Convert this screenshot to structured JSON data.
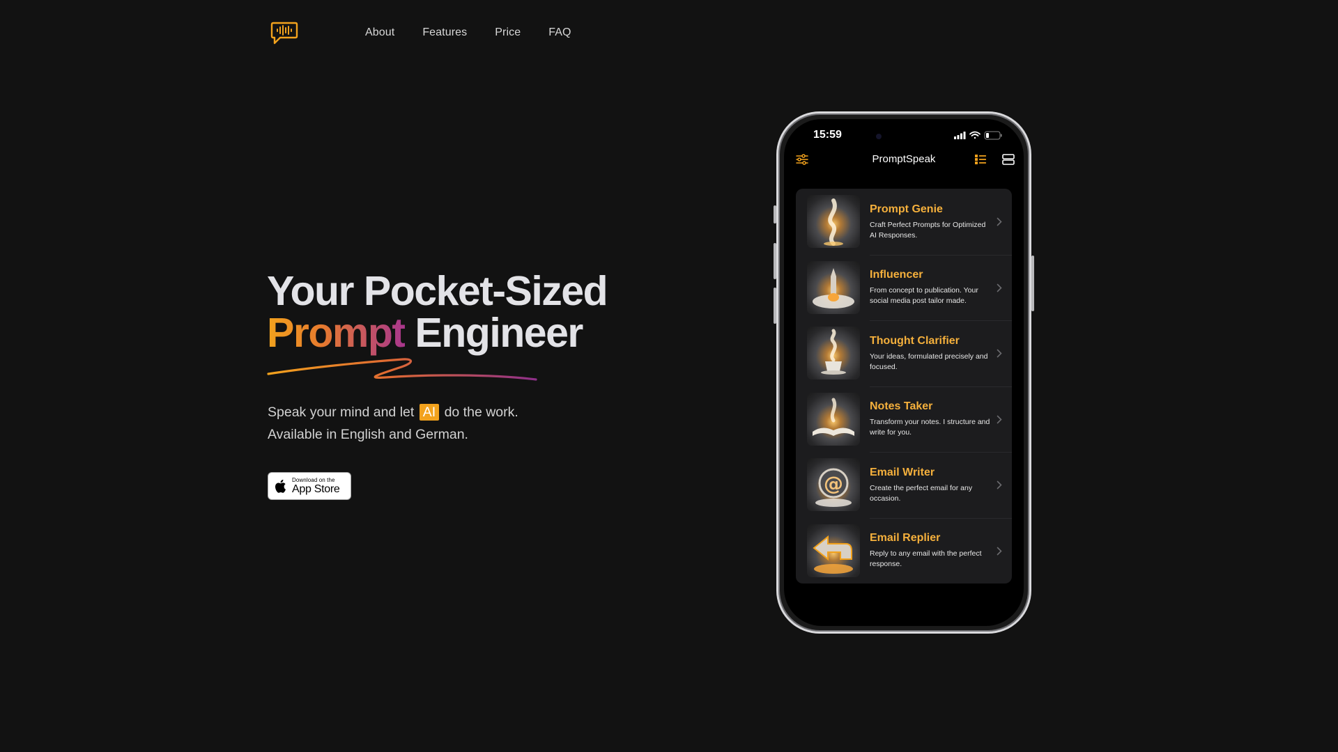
{
  "nav": {
    "logo_icon": "speech-bubble-waveform-icon",
    "items": [
      "About",
      "Features",
      "Price",
      "FAQ"
    ]
  },
  "hero": {
    "title_line1": "Your Pocket-Sized",
    "title_highlight": "Prompt",
    "title_line2_rest": " Engineer",
    "subtitle_before": "Speak your mind and let ",
    "subtitle_badge": "AI",
    "subtitle_after": " do the work.",
    "subtitle_line2": "Available in English and German.",
    "appstore_small": "Download on the",
    "appstore_big": "App Store"
  },
  "phone": {
    "status_time": "15:59",
    "app_title": "PromptSpeak",
    "items": [
      {
        "title": "Prompt Genie",
        "desc": "Craft Perfect Prompts for Optimized AI Responses.",
        "icon": "genie-smoke-icon"
      },
      {
        "title": "Influencer",
        "desc": "From concept to publication. Your social media post tailor made.",
        "icon": "rocket-launch-icon"
      },
      {
        "title": "Thought Clarifier",
        "desc": "Your ideas, formulated precisely and focused.",
        "icon": "coffee-cup-steam-icon"
      },
      {
        "title": "Notes Taker",
        "desc": "Transform your notes. I structure and write for you.",
        "icon": "open-book-icon"
      },
      {
        "title": "Email Writer",
        "desc": "Create the perfect email for any occasion.",
        "icon": "at-sign-icon"
      },
      {
        "title": "Email Replier",
        "desc": "Reply to any email with the perfect response.",
        "icon": "reply-arrow-icon"
      }
    ]
  },
  "colors": {
    "background": "#121212",
    "accent": "#f2a21d",
    "gradient_end": "#a8368d",
    "row_title": "#f5b03c"
  }
}
